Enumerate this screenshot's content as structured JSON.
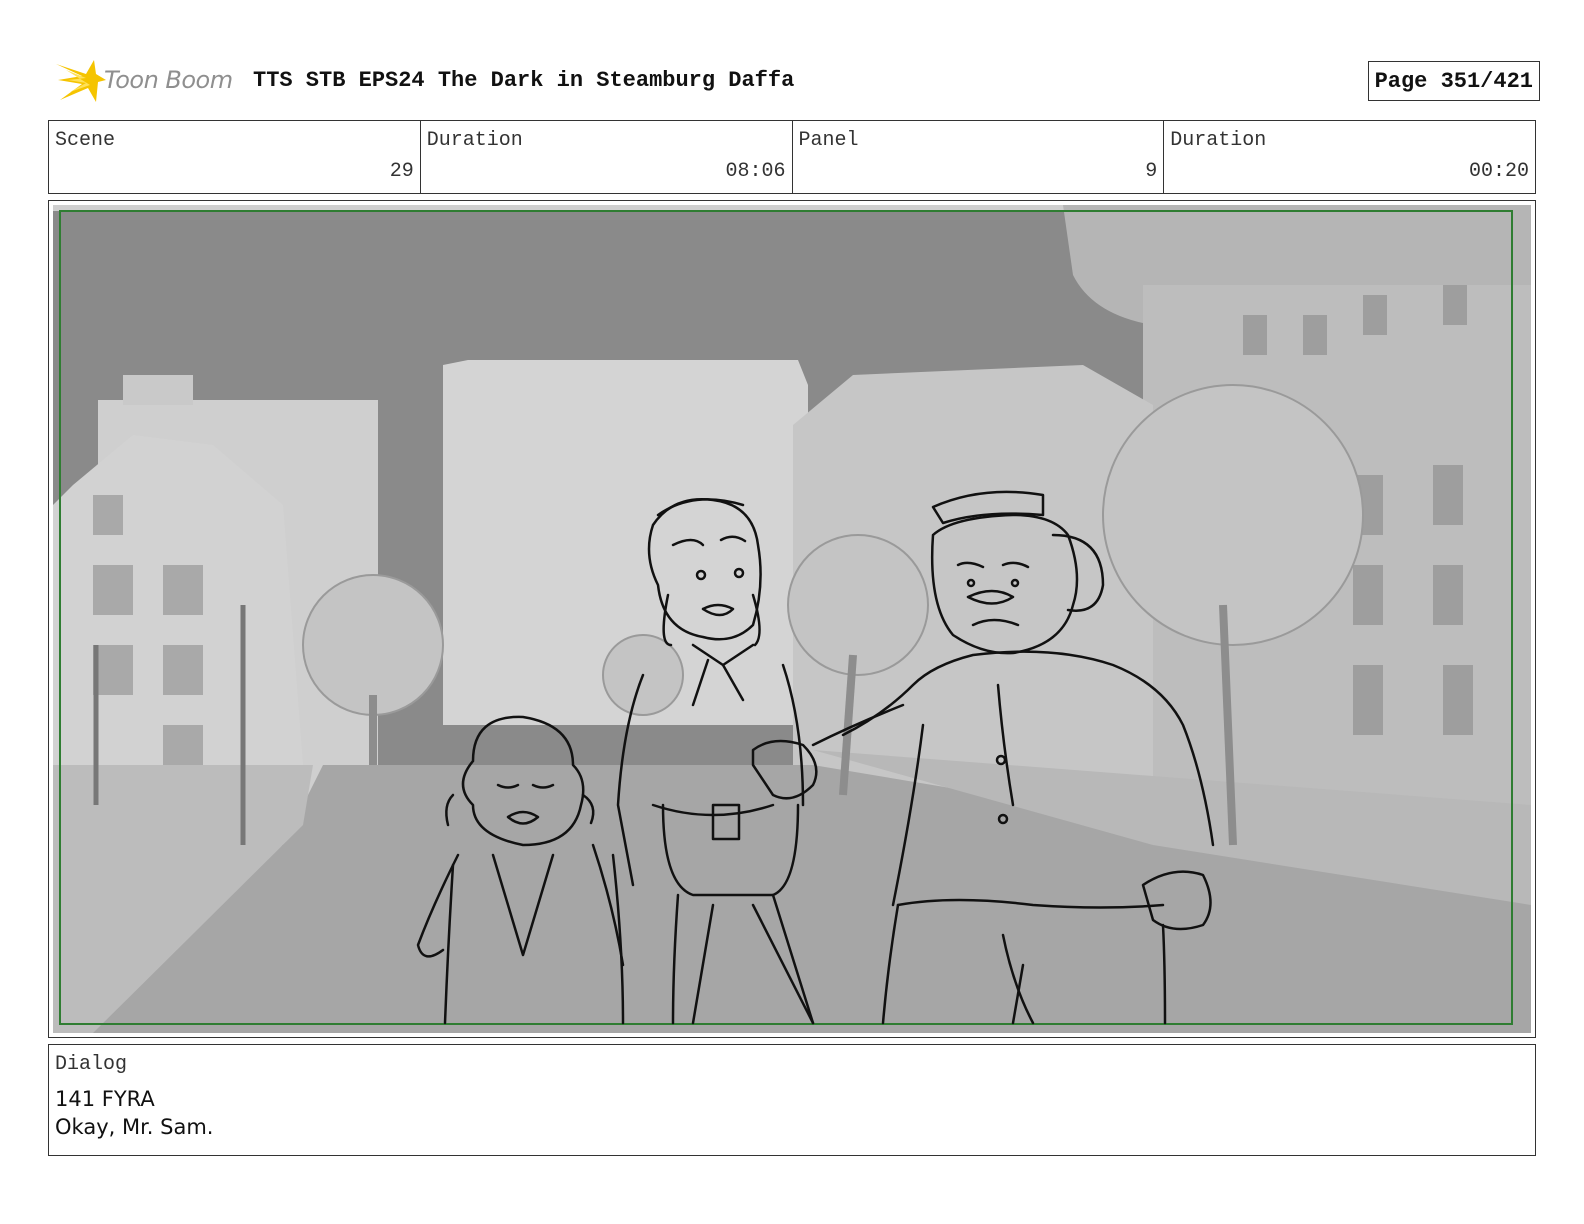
{
  "header": {
    "logo_text": "Toon Boom",
    "title": "TTS STB EPS24 The Dark in Steamburg Daffa",
    "page": "Page 351/421"
  },
  "info": {
    "scene_label": "Scene",
    "scene_value": "29",
    "duration_label": "Duration",
    "duration_value": "08:06",
    "panel_label": "Panel",
    "panel_value": "9",
    "panel_duration_label": "Duration",
    "panel_duration_value": "00:20"
  },
  "dialog": {
    "label": "Dialog",
    "lines": [
      "141 FYRA",
      "Okay, Mr. Sam."
    ]
  },
  "colors": {
    "logo_accent": "#f5c400",
    "frame_green": "#2f7d32",
    "sky": "#8a8a8a"
  }
}
